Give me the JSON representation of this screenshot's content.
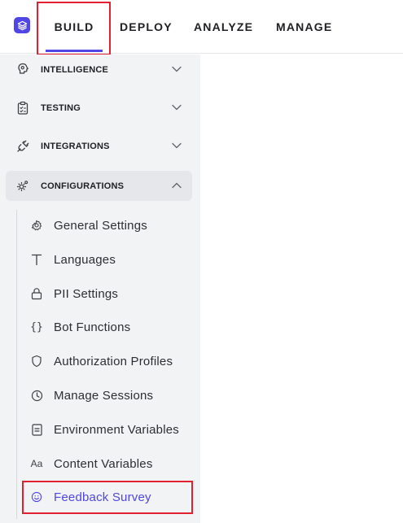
{
  "topnav": {
    "tabs": [
      {
        "label": "BUILD",
        "active": true
      },
      {
        "label": "DEPLOY",
        "active": false
      },
      {
        "label": "ANALYZE",
        "active": false
      },
      {
        "label": "MANAGE",
        "active": false
      }
    ]
  },
  "sidebar": {
    "sections": [
      {
        "label": "INTELLIGENCE",
        "icon": "brain-icon",
        "expanded": false
      },
      {
        "label": "TESTING",
        "icon": "clipboard-icon",
        "expanded": false
      },
      {
        "label": "INTEGRATIONS",
        "icon": "plug-icon",
        "expanded": false
      },
      {
        "label": "CONFIGURATIONS",
        "icon": "gears-icon",
        "expanded": true
      }
    ],
    "configurations_items": [
      {
        "label": "General Settings",
        "icon": "gear-icon"
      },
      {
        "label": "Languages",
        "icon": "text-icon"
      },
      {
        "label": "PII Settings",
        "icon": "lock-icon"
      },
      {
        "label": "Bot Functions",
        "icon": "braces-icon"
      },
      {
        "label": "Authorization Profiles",
        "icon": "shield-icon"
      },
      {
        "label": "Manage Sessions",
        "icon": "clock-icon"
      },
      {
        "label": "Environment Variables",
        "icon": "document-icon"
      },
      {
        "label": "Content Variables",
        "icon": "font-icon",
        "glyph": "Aa"
      },
      {
        "label": "Feedback Survey",
        "icon": "smile-icon",
        "selected": true
      }
    ]
  },
  "colors": {
    "accent": "#4f46e5",
    "highlight": "#e3202f",
    "sidebar_bg": "#f2f3f5"
  }
}
